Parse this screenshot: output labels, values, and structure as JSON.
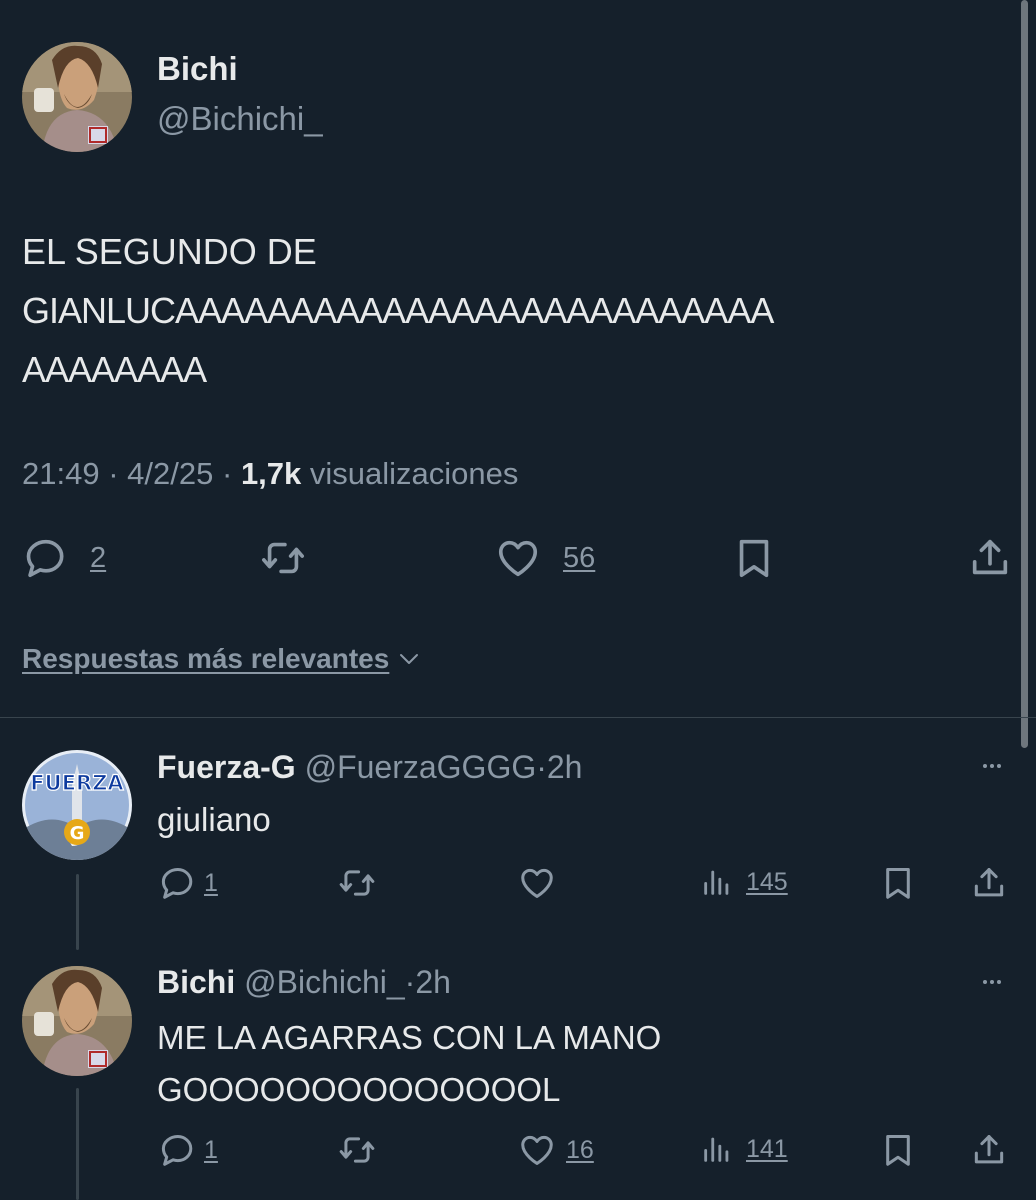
{
  "main_tweet": {
    "author_name": "Bichi",
    "author_handle": "@Bichichi_",
    "text_lines": [
      "EL SEGUNDO DE",
      "GIANLUCAAAAAAAAAAAAAAAAAAAAAAAAAA",
      "AAAAAAAA"
    ],
    "time": "21:49",
    "date": "4/2/25",
    "views_count": "1,7k",
    "views_label": "visualizaciones",
    "separator": "·",
    "replies": "2",
    "likes": "56"
  },
  "sort_label": "Respuestas más relevantes",
  "replies": [
    {
      "author_name": "Fuerza-G",
      "author_handle": "@FuerzaGGGG",
      "time": "2h",
      "separator": "·",
      "text_lines": [
        "giuliano"
      ],
      "replies": "1",
      "likes": "",
      "views": "145",
      "avatar_text": "FUERZA",
      "avatar_letter": "G"
    },
    {
      "author_name": "Bichi",
      "author_handle": "@Bichichi_",
      "time": "2h",
      "separator": "·",
      "text_lines": [
        "ME LA AGARRAS CON LA MANO",
        "GOOOOOOOOOOOOOOL"
      ],
      "replies": "1",
      "likes": "16",
      "views": "141"
    }
  ],
  "icons": {
    "reply": "reply-icon",
    "retweet": "retweet-icon",
    "like": "heart-icon",
    "bookmark": "bookmark-icon",
    "share": "share-icon",
    "views": "views-icon",
    "more": "more-icon",
    "chevron": "chevron-down-icon"
  },
  "colors": {
    "background": "#15202b",
    "text": "#e7e9ea",
    "muted": "#8b98a5",
    "divider": "#38444d"
  }
}
